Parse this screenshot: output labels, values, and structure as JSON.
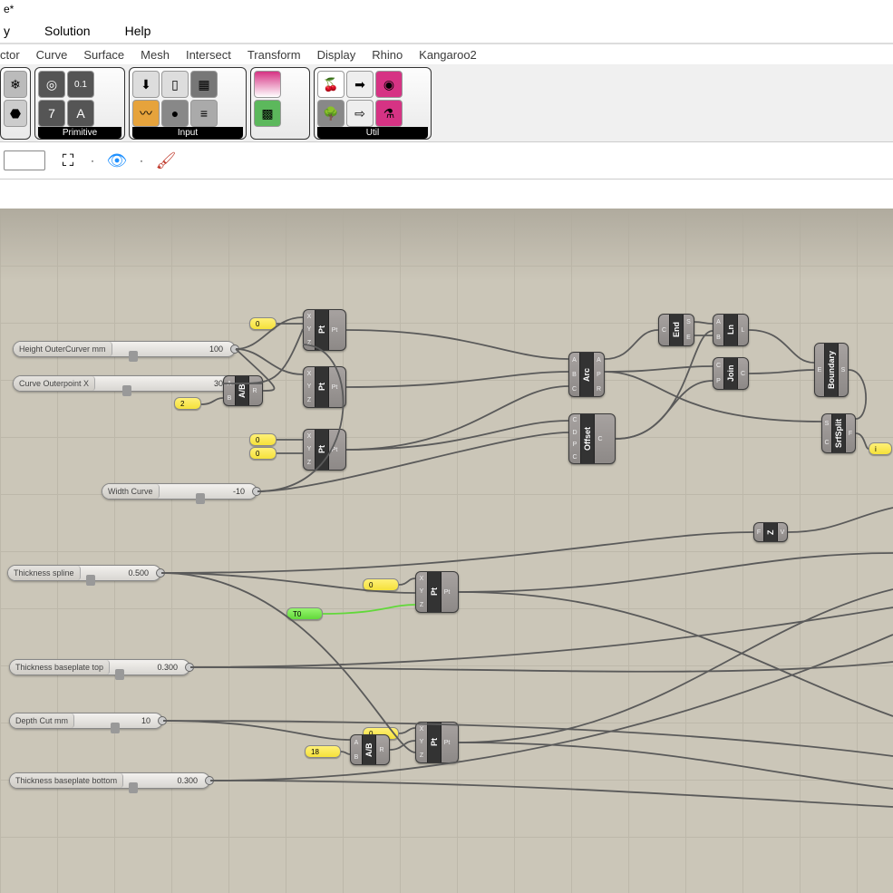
{
  "title": "e*",
  "menu": {
    "display": "y",
    "solution": "Solution",
    "help": "Help"
  },
  "tabs": {
    "vector": "ctor",
    "curve": "Curve",
    "surface": "Surface",
    "mesh": "Mesh",
    "intersect": "Intersect",
    "transform": "Transform",
    "display": "Display",
    "rhino": "Rhino",
    "kangaroo": "Kangaroo2"
  },
  "ribbon": {
    "primitive": "Primitive",
    "input": "Input",
    "util": "Util"
  },
  "sliders": {
    "height_outer": {
      "label": "Height OuterCurver mm",
      "value": "100"
    },
    "curve_outerpoint": {
      "label": "Curve Outerpoint X",
      "value": "30"
    },
    "width_curve": {
      "label": "Width Curve",
      "value": "-10"
    },
    "thickness_spline": {
      "label": "Thickness spline",
      "value": "0.500"
    },
    "thickness_base_top": {
      "label": "Thickness baseplate top",
      "value": "0.300"
    },
    "depth_cut": {
      "label": "Depth Cut mm",
      "value": "10"
    },
    "thickness_base_bot": {
      "label": "Thickness baseplate bottom",
      "value": "0.300"
    }
  },
  "panels": {
    "p0a": "0",
    "p2": "2",
    "p0b": "0",
    "p0c": "0",
    "p0d": "0",
    "pT0": "T0",
    "p0e": "0",
    "p18": "18",
    "pi": "i"
  },
  "components": {
    "pt": "Pt",
    "ab": "A/B",
    "arc": "Arc",
    "offset": "Offset",
    "end": "End",
    "ln": "Ln",
    "join": "Join",
    "boundary": "Boundary",
    "srfsplit": "SrfSplit",
    "z": "Z"
  }
}
